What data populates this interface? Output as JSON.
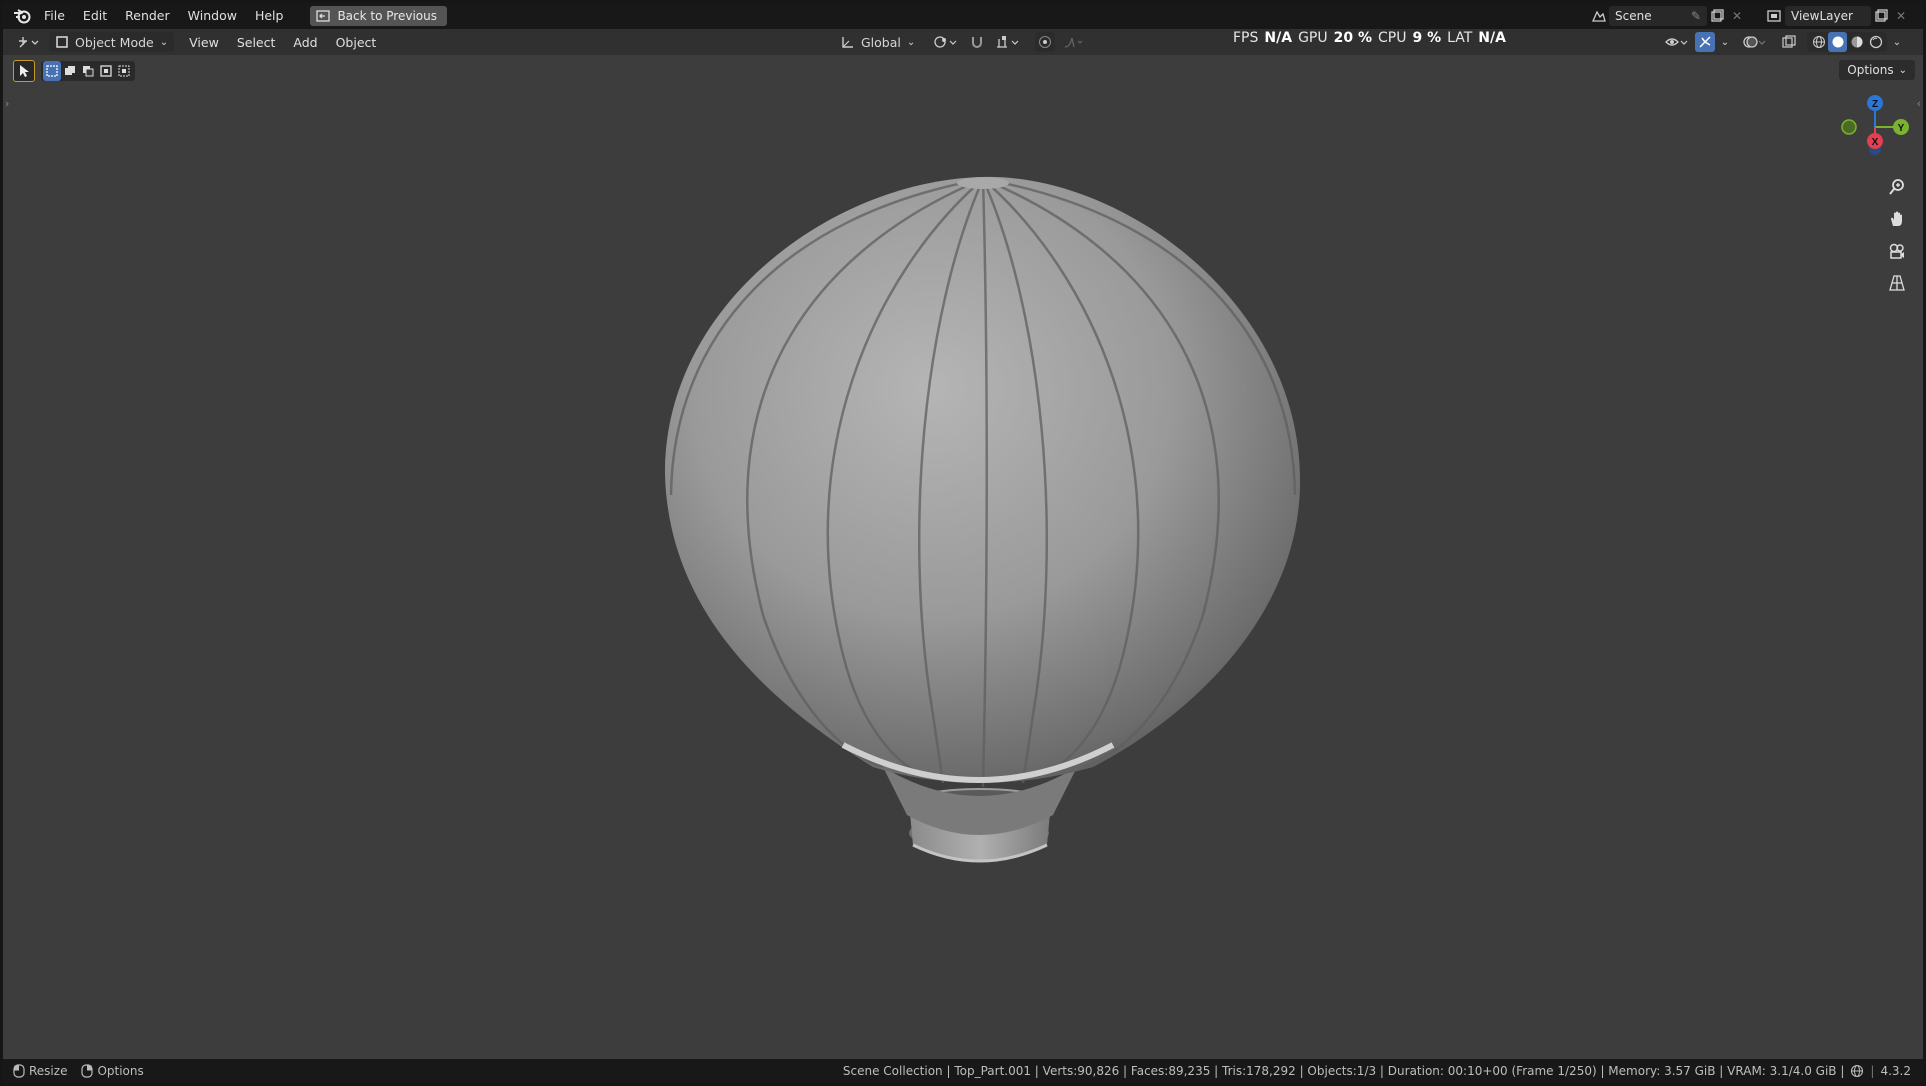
{
  "menubar": {
    "items": [
      "File",
      "Edit",
      "Render",
      "Window",
      "Help"
    ],
    "back_label": "Back to Previous",
    "scene": "Scene",
    "view_layer": "ViewLayer"
  },
  "header": {
    "mode": "Object Mode",
    "menus": [
      "View",
      "Select",
      "Add",
      "Object"
    ],
    "orientation": "Global",
    "options": "Options"
  },
  "stats": {
    "fps_label": "FPS",
    "fps_value": "N/A",
    "gpu_label": "GPU",
    "gpu_value": "20 %",
    "cpu_label": "CPU",
    "cpu_value": "9 %",
    "lat_label": "LAT",
    "lat_value": "N/A"
  },
  "gizmo": {
    "z": "Z",
    "y": "Y",
    "x": "X"
  },
  "status": {
    "left": [
      "Resize",
      "Options"
    ],
    "info": "Scene Collection | Top_Part.001 | Verts:90,826 | Faces:89,235 | Tris:178,292 | Objects:1/3 | Duration: 00:10+00 (Frame 1/250) | Memory: 3.57 GiB | VRAM: 3.1/4.0 GiB |",
    "version": "4.3.2"
  },
  "colors": {
    "axis_x": "#e0404f",
    "axis_y": "#7ab32e",
    "axis_z": "#2b76d8",
    "active_blue": "#4772b3"
  }
}
